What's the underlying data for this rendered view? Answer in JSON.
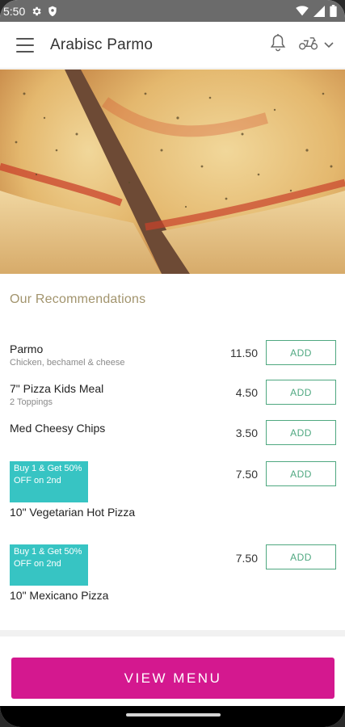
{
  "status_bar": {
    "time": "5:50"
  },
  "app_bar": {
    "title": "Arabisc Parmo"
  },
  "section": {
    "title": "Our Recommendations"
  },
  "items": [
    {
      "name": "Parmo",
      "description": "Chicken, bechamel & cheese",
      "price": "11.50",
      "add_label": "ADD"
    },
    {
      "name": "7\" Pizza Kids Meal",
      "description": "2 Toppings",
      "price": "4.50",
      "add_label": "ADD"
    },
    {
      "name": "Med Cheesy Chips",
      "description": "",
      "price": "3.50",
      "add_label": "ADD"
    },
    {
      "name": "10\" Vegetarian Hot Pizza",
      "description": "",
      "price": "7.50",
      "add_label": "ADD",
      "promo": "Buy 1 & Get 50% OFF on 2nd"
    },
    {
      "name": "10\" Mexicano Pizza",
      "description": "",
      "price": "7.50",
      "add_label": "ADD",
      "promo": "Buy 1 & Get 50% OFF on 2nd"
    }
  ],
  "footer": {
    "view_menu_label": "VIEW MENU"
  },
  "colors": {
    "accent": "#d4188f",
    "add_green": "#4fa880",
    "promo_teal": "#37c4c3",
    "section_title": "#a2946d"
  }
}
